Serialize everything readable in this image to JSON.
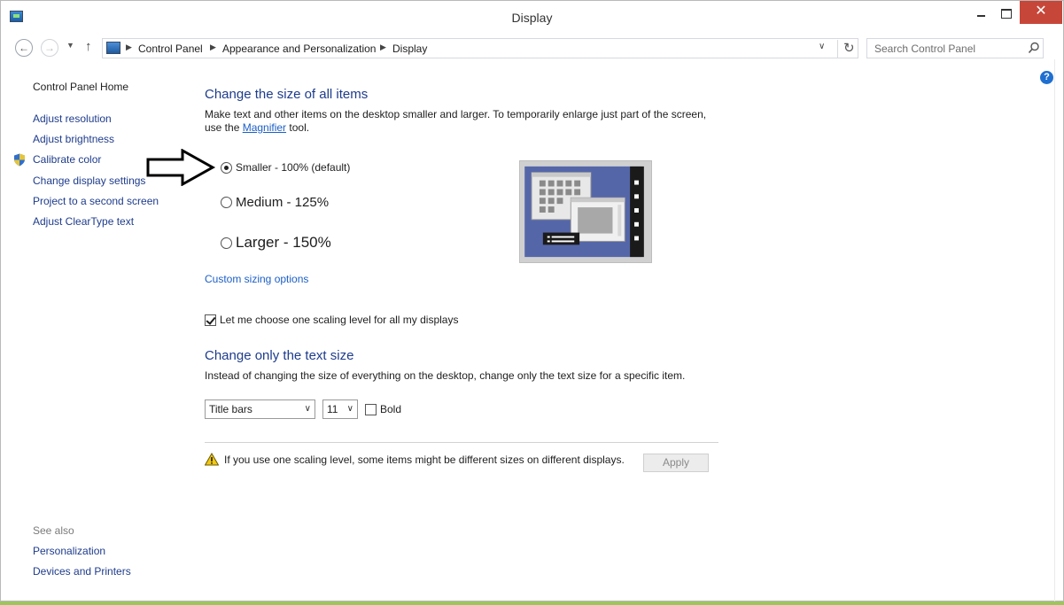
{
  "window": {
    "title": "Display",
    "close_glyph": "✕"
  },
  "nav": {
    "back_glyph": "←",
    "forward_glyph": "→",
    "recent_glyph": "▼",
    "up_glyph": "↑",
    "breadcrumb": [
      "Control Panel",
      "Appearance and Personalization",
      "Display"
    ],
    "dropdown_glyph": "∨",
    "refresh_glyph": "↻",
    "search_placeholder": "Search Control Panel"
  },
  "sidebar": {
    "home": "Control Panel Home",
    "items": [
      "Adjust resolution",
      "Adjust brightness",
      "Calibrate color",
      "Change display settings",
      "Project to a second screen",
      "Adjust ClearType text"
    ],
    "see_also_label": "See also",
    "see_also": [
      "Personalization",
      "Devices and Printers"
    ]
  },
  "content": {
    "heading_size": "Change the size of all items",
    "desc_line1": "Make text and other items on the desktop smaller and larger. To temporarily enlarge just part of the screen,",
    "desc_line2_prefix": "use the ",
    "magnifier_link": "Magnifier",
    "desc_line2_suffix": " tool.",
    "options": [
      {
        "label": "Smaller - 100% (default)",
        "checked": true
      },
      {
        "label": "Medium - 125%",
        "checked": false
      },
      {
        "label": "Larger - 150%",
        "checked": false
      }
    ],
    "custom_link": "Custom sizing options",
    "scale_check_label": "Let me choose one scaling level for all my displays",
    "scale_checked": true,
    "heading_text": "Change only the text size",
    "desc_text": "Instead of changing the size of everything on the desktop, change only the text size for a specific item.",
    "item_select": "Title bars",
    "size_select": "11",
    "select_chevron": "∨",
    "bold_label": "Bold",
    "bold_checked": false,
    "warning": "If you use one scaling level, some items might be different sizes on different displays.",
    "apply_label": "Apply"
  },
  "colors": {
    "link": "#1e3c8c",
    "accent_link": "#1c5fc7",
    "close_button": "#c7463a",
    "preview_blue": "#5566a8"
  }
}
